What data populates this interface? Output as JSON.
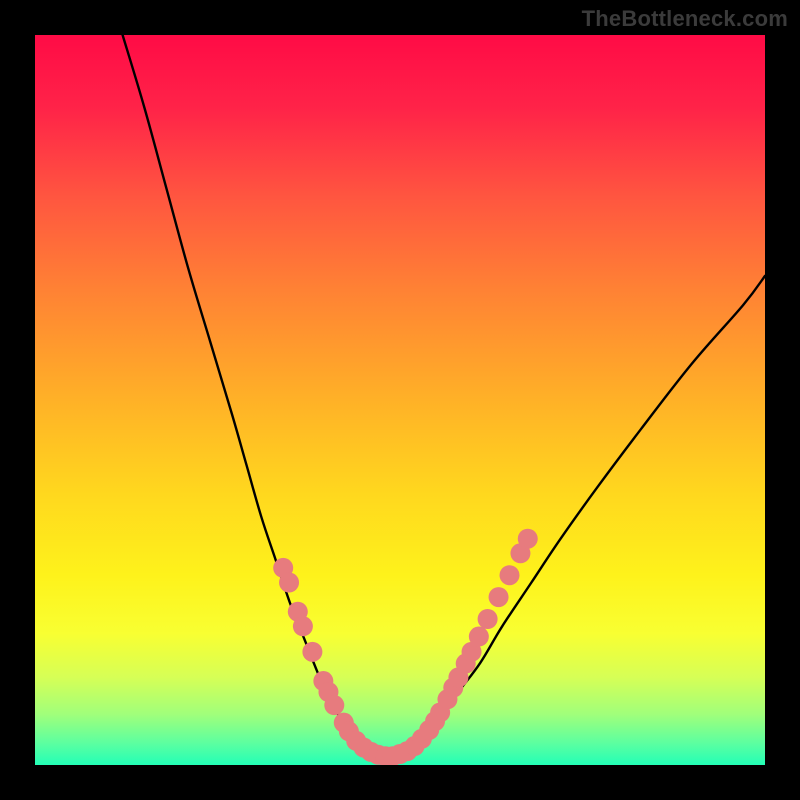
{
  "watermark": "TheBottleneck.com",
  "gradient": {
    "stops": [
      {
        "offset": 0.0,
        "color": "#ff0b46"
      },
      {
        "offset": 0.1,
        "color": "#ff2348"
      },
      {
        "offset": 0.22,
        "color": "#ff5540"
      },
      {
        "offset": 0.35,
        "color": "#ff8234"
      },
      {
        "offset": 0.5,
        "color": "#ffb127"
      },
      {
        "offset": 0.63,
        "color": "#ffd81e"
      },
      {
        "offset": 0.74,
        "color": "#fef21b"
      },
      {
        "offset": 0.82,
        "color": "#f8ff32"
      },
      {
        "offset": 0.88,
        "color": "#d6ff56"
      },
      {
        "offset": 0.93,
        "color": "#a1ff7a"
      },
      {
        "offset": 0.97,
        "color": "#5cffa0"
      },
      {
        "offset": 1.0,
        "color": "#23ffb6"
      }
    ]
  },
  "chart_data": {
    "type": "line",
    "title": "",
    "xlabel": "",
    "ylabel": "",
    "xlim": [
      0,
      100
    ],
    "ylim": [
      0,
      100
    ],
    "series": [
      {
        "name": "curve-left",
        "x": [
          12,
          15,
          18,
          21,
          24,
          27,
          29,
          31,
          33,
          35,
          37,
          39,
          40.5,
          42,
          43.5,
          45
        ],
        "y": [
          100,
          90,
          79,
          68,
          58,
          48,
          41,
          34,
          28,
          22,
          17,
          12,
          9,
          6,
          3.5,
          2
        ]
      },
      {
        "name": "curve-bottom",
        "x": [
          45,
          46,
          47,
          48,
          49,
          50,
          51,
          52
        ],
        "y": [
          2,
          1.4,
          1.1,
          1.0,
          1.1,
          1.4,
          1.8,
          2.3
        ]
      },
      {
        "name": "curve-right",
        "x": [
          52,
          54,
          56,
          58,
          61,
          64,
          68,
          72,
          77,
          83,
          90,
          97,
          100
        ],
        "y": [
          2.3,
          4.5,
          7,
          10,
          14,
          19,
          25,
          31,
          38,
          46,
          55,
          63,
          67
        ]
      }
    ],
    "markers": {
      "color": "#e77b7e",
      "radius": 10,
      "points": [
        {
          "x": 34.0,
          "y": 27
        },
        {
          "x": 34.8,
          "y": 25
        },
        {
          "x": 36.0,
          "y": 21
        },
        {
          "x": 36.7,
          "y": 19
        },
        {
          "x": 38.0,
          "y": 15.5
        },
        {
          "x": 39.5,
          "y": 11.5
        },
        {
          "x": 40.2,
          "y": 10
        },
        {
          "x": 41.0,
          "y": 8.2
        },
        {
          "x": 42.3,
          "y": 5.8
        },
        {
          "x": 43.0,
          "y": 4.6
        },
        {
          "x": 44.0,
          "y": 3.3
        },
        {
          "x": 45.0,
          "y": 2.4
        },
        {
          "x": 46.0,
          "y": 1.8
        },
        {
          "x": 47.0,
          "y": 1.4
        },
        {
          "x": 48.0,
          "y": 1.2
        },
        {
          "x": 49.0,
          "y": 1.2
        },
        {
          "x": 50.0,
          "y": 1.5
        },
        {
          "x": 51.0,
          "y": 1.9
        },
        {
          "x": 52.0,
          "y": 2.6
        },
        {
          "x": 53.0,
          "y": 3.6
        },
        {
          "x": 54.0,
          "y": 4.8
        },
        {
          "x": 54.8,
          "y": 6.0
        },
        {
          "x": 55.5,
          "y": 7.2
        },
        {
          "x": 56.5,
          "y": 9.0
        },
        {
          "x": 57.3,
          "y": 10.6
        },
        {
          "x": 58.0,
          "y": 12.0
        },
        {
          "x": 59.0,
          "y": 13.9
        },
        {
          "x": 59.8,
          "y": 15.5
        },
        {
          "x": 60.8,
          "y": 17.6
        },
        {
          "x": 62.0,
          "y": 20.0
        },
        {
          "x": 63.5,
          "y": 23.0
        },
        {
          "x": 65.0,
          "y": 26.0
        },
        {
          "x": 66.5,
          "y": 29.0
        },
        {
          "x": 67.5,
          "y": 31.0
        }
      ]
    }
  }
}
